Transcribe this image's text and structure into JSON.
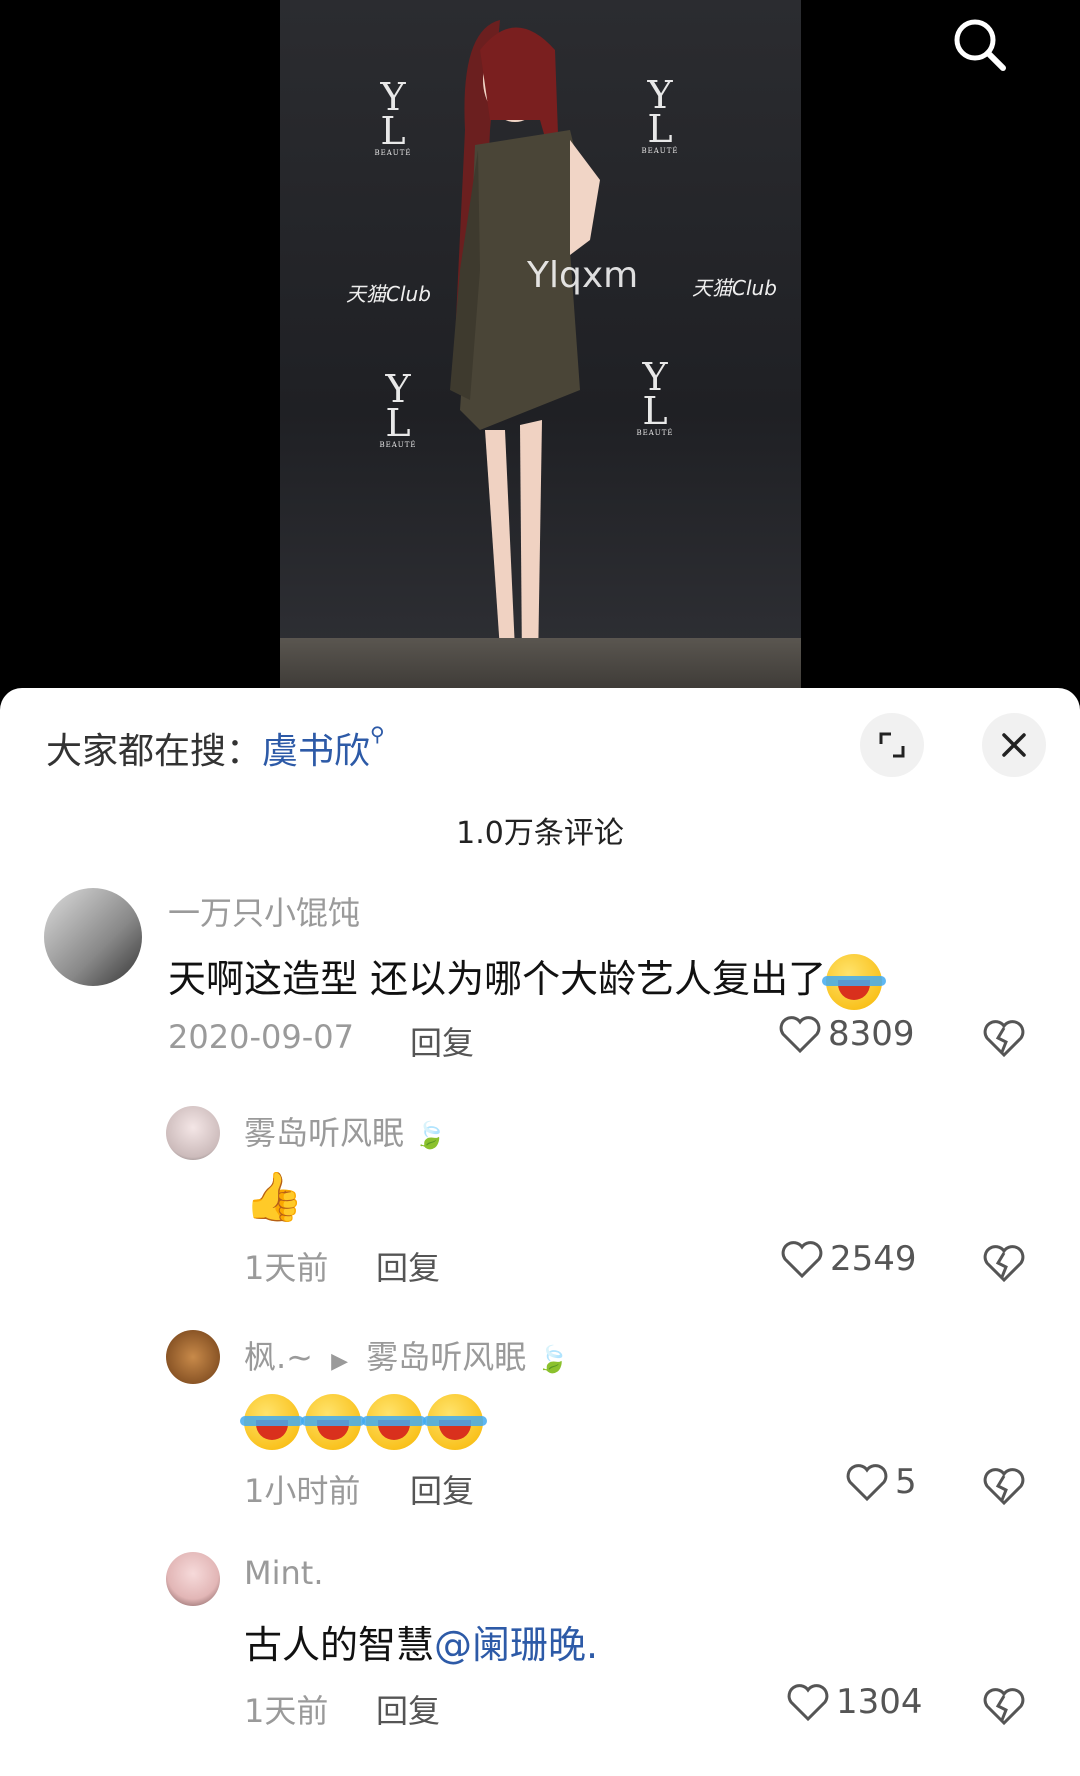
{
  "video": {
    "watermark": "Ylqxm",
    "brand_left": "天猫Club",
    "brand_right": "天猫Club",
    "logo_letters": "YSL",
    "logo_sub": "BEAUTÉ"
  },
  "hot_search": {
    "prefix": "大家都在搜：",
    "keyword": "虞书欣",
    "icon": "search-icon"
  },
  "comments_count": "1.0万条评论",
  "comments": [
    {
      "user": "一万只小馄饨",
      "text": "天啊这造型 还以为哪个大龄艺人复出了",
      "time": "2020-09-07",
      "reply": "回复",
      "likes": "8309"
    },
    {
      "user": "雾岛听风眠",
      "time": "1天前",
      "reply": "回复",
      "likes": "2549"
    },
    {
      "user": "枫.~",
      "reply_to": "雾岛听风眠",
      "time": "1小时前",
      "reply": "回复",
      "likes": "5"
    },
    {
      "user": "Mint.",
      "text": "古人的智慧",
      "mention": "@阑珊晚.",
      "time": "1天前",
      "reply": "回复",
      "likes": "1304"
    }
  ],
  "colors": {
    "link": "#2d5aa7",
    "sheet_bg": "#ffffff",
    "video_bg": "#000000"
  }
}
